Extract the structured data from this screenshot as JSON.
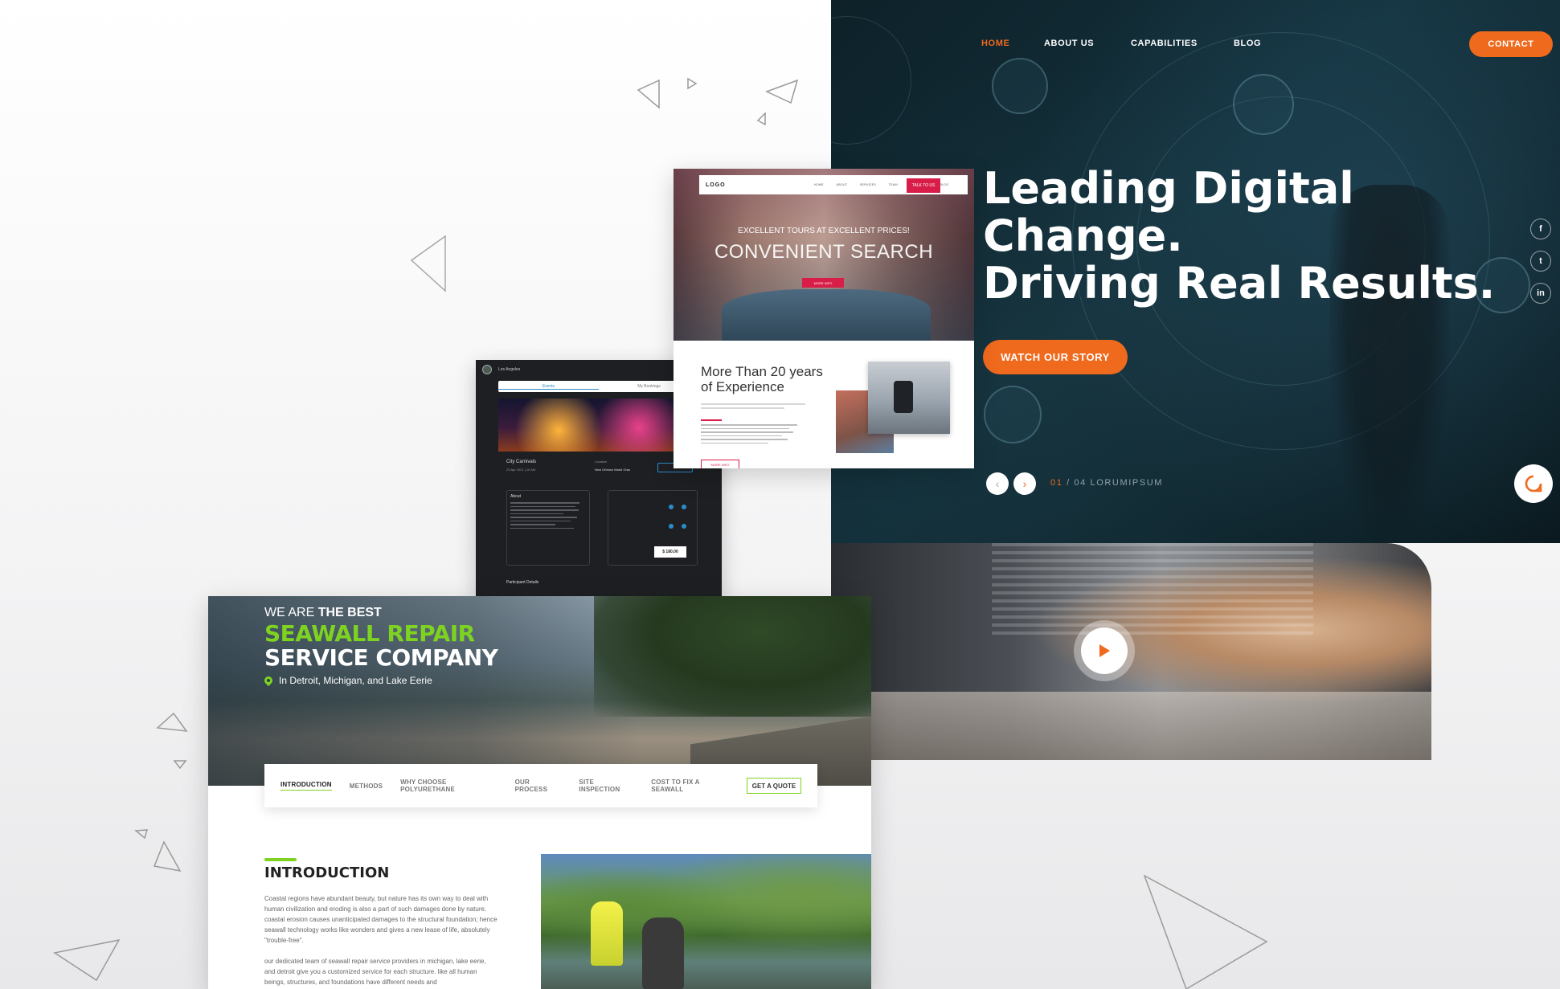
{
  "hero": {
    "nav": [
      "HOME",
      "ABOUT US",
      "CAPABILITIES",
      "BLOG"
    ],
    "contact": "CONTACT",
    "headline": [
      "Leading Digital",
      "Change.",
      "Driving Real Results."
    ],
    "cta": "WATCH OUR STORY",
    "slide_current": "01",
    "slide_rest": " / 04 LORUMIPSUM",
    "social": [
      "f",
      "t",
      "in"
    ],
    "accent_color": "#f06a1d"
  },
  "travel": {
    "logo": "LOGO",
    "nav": [
      "HOME",
      "ABOUT",
      "SERVICES",
      "TEAM",
      "PROJECTS",
      "BLOG"
    ],
    "talk_btn": "TALK TO US",
    "tagline": "EXCELLENT TOURS AT EXCELLENT PRICES!",
    "headline": "CONVENIENT SEARCH",
    "more_btn": "MORE INFO",
    "exp_title": "More Than 20 years of Experience",
    "more_btn2": "MORE INFO",
    "accent_color": "#d81e48"
  },
  "events": {
    "location": "Los Angeles",
    "tabs": [
      "Events",
      "My Bookings"
    ],
    "event_name": "City Carnivals",
    "event_date": "23 Apr 2021 | 10 AM",
    "location_label": "Location",
    "location_value": "New Orleans Mardi Gras",
    "about": "About",
    "price": "$ 180.00",
    "participant": "Participant Details"
  },
  "seawall": {
    "pre_normal": "WE ARE ",
    "pre_bold": "THE BEST",
    "h1": "SEAWALL REPAIR",
    "h2": "SERVICE COMPANY",
    "location": "In Detroit, Michigan, and Lake Eerie",
    "tabs": [
      "INTRODUCTION",
      "METHODS",
      "WHY CHOOSE POLYURETHANE",
      "OUR PROCESS",
      "SITE INSPECTION",
      "COST TO FIX A SEAWALL"
    ],
    "quote_btn": "GET A QUOTE",
    "intro_heading": "INTRODUCTION",
    "intro_p1": "Coastal regions have abundant beauty, but nature has its own way to deal with human civilization and eroding is also a part of such damages done by nature. coastal erosion causes unanticipated damages to the structural foundation; hence seawall technology works like wonders and gives a new lease of life, absolutely \"trouble-free\".",
    "intro_p2": "our dedicated team of seawall repair service providers in michigan, lake eerie, and detroit give you a customized service for each structure. like all human beings, structures, and foundations have different needs and",
    "accent_color": "#7ed321"
  }
}
